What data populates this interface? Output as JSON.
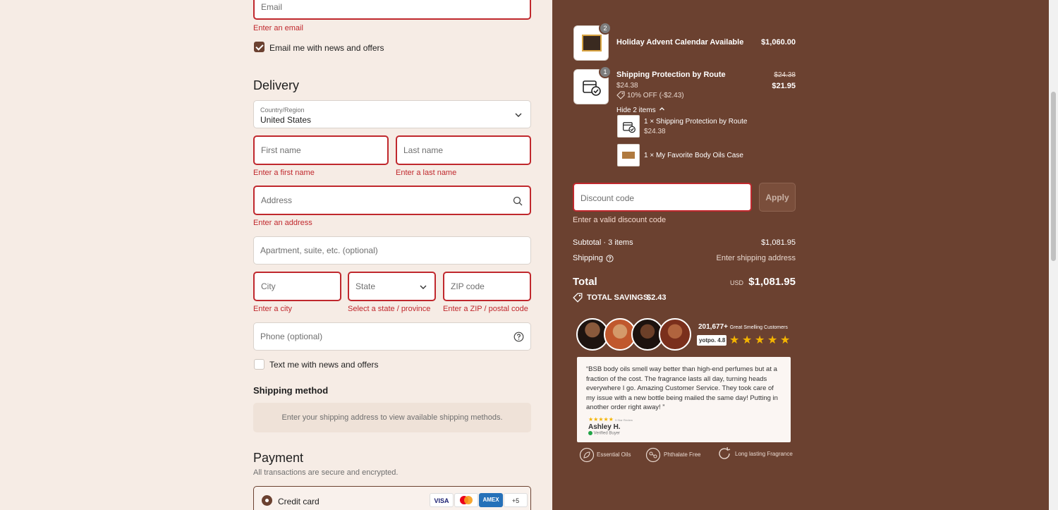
{
  "contact": {
    "email_placeholder": "Email",
    "email_error": "Enter an email",
    "news_label": "Email me with news and offers"
  },
  "delivery": {
    "title": "Delivery",
    "country_label": "Country/Region",
    "country_value": "United States",
    "first_name_placeholder": "First name",
    "first_name_error": "Enter a first name",
    "last_name_placeholder": "Last name",
    "last_name_error": "Enter a last name",
    "address_placeholder": "Address",
    "address_error": "Enter an address",
    "apartment_placeholder": "Apartment, suite, etc. (optional)",
    "city_placeholder": "City",
    "city_error": "Enter a city",
    "state_placeholder": "State",
    "state_error": "Select a state / province",
    "zip_placeholder": "ZIP code",
    "zip_error": "Enter a ZIP / postal code",
    "phone_placeholder": "Phone (optional)",
    "text_label": "Text me with news and offers"
  },
  "shipping_method": {
    "title": "Shipping method",
    "notice": "Enter your shipping address to view available shipping methods."
  },
  "payment": {
    "title": "Payment",
    "subtitle": "All transactions are secure and encrypted.",
    "credit_card_label": "Credit card",
    "cards": [
      "VISA",
      "",
      "AMEX",
      "+5"
    ]
  },
  "summary": {
    "items": [
      {
        "qty": "2",
        "name": "Holiday Advent Calendar Available",
        "price": "$1,060.00"
      },
      {
        "qty": "1",
        "name": "Shipping Protection by Route",
        "unit_price": "$24.38",
        "discount": "10% OFF (-$2.43)",
        "old_price": "$24.38",
        "price": "$21.95"
      }
    ],
    "hide_items": "Hide 2 items",
    "bundle": [
      {
        "name": "1 × Shipping Protection by Route",
        "price": "$24.38"
      },
      {
        "name": "1 × My Favorite Body Oils Case"
      }
    ],
    "discount_placeholder": "Discount code",
    "apply_label": "Apply",
    "discount_error": "Enter a valid discount code",
    "subtotal_label": "Subtotal · 3 items",
    "subtotal_value": "$1,081.95",
    "shipping_label": "Shipping",
    "shipping_value": "Enter shipping address",
    "total_label": "Total",
    "currency": "USD",
    "total_value": "$1,081.95",
    "savings_label": "TOTAL SAVINGS",
    "savings_value": "$2.43"
  },
  "social_proof": {
    "count": "201,677+",
    "count_label": "Great Smelling Customers",
    "yotpo": "yotpo.",
    "rating": "4.8",
    "review": "“BSB body oils smell way better than high-end perfumes but at a fraction of the cost. The fragrance lasts all day, turning heads everywhere I go. Amazing Customer Service. They took care of my issue with a new bottle being mailed the same day! Putting in another order right away! ”",
    "review_stars_label": "5 Star Review",
    "reviewer": "Ashley H.",
    "verified": "Verified Buyer",
    "features": [
      "Essential Oils",
      "Phthalate Free",
      "Long lasting Fragrance"
    ]
  }
}
